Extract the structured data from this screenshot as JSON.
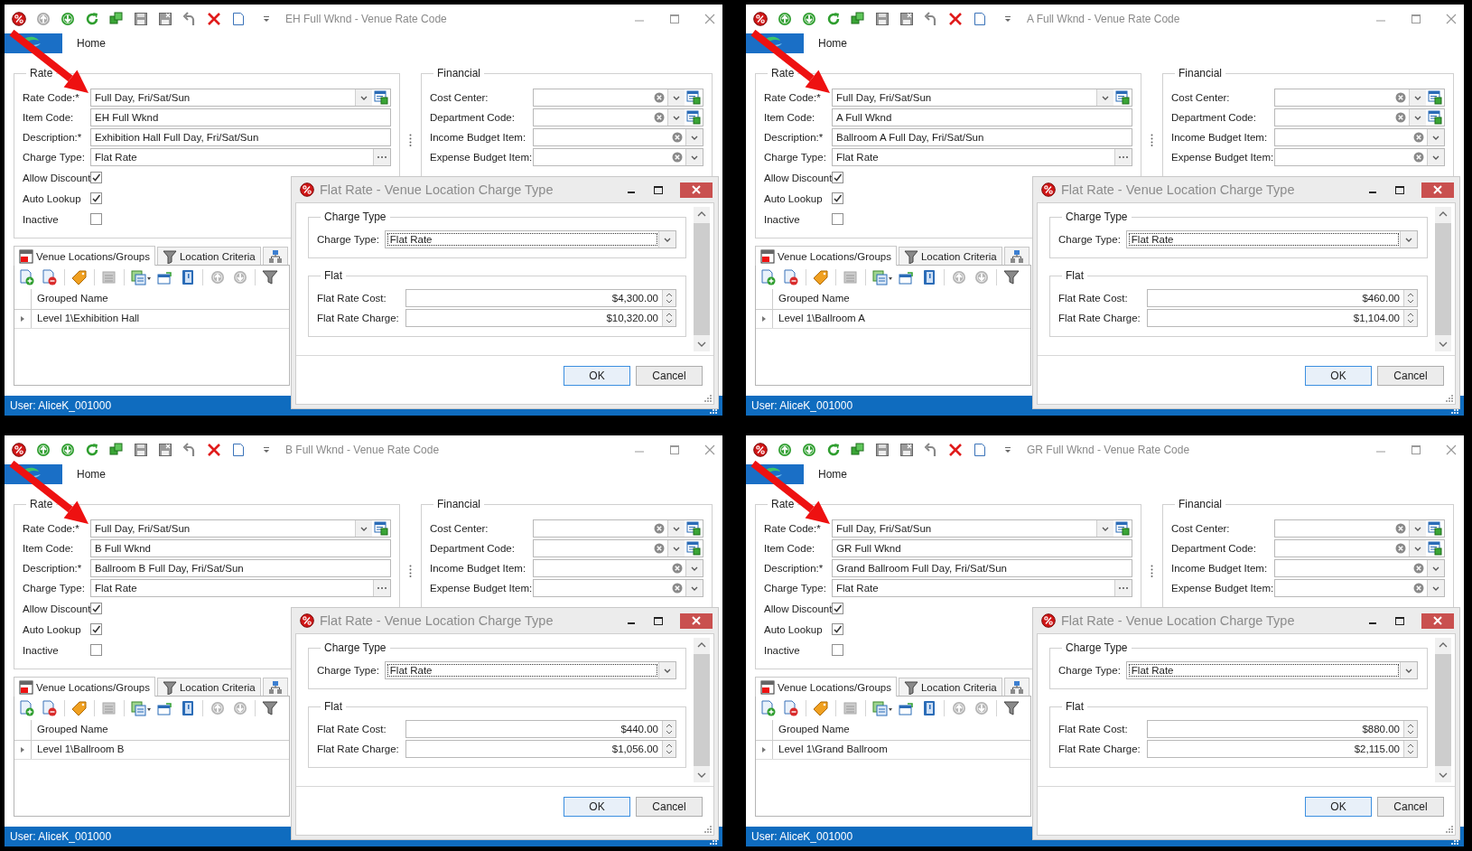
{
  "windows": [
    {
      "title": "EH Full Wknd - Venue Rate Code",
      "move_up": {
        "disabled": true
      },
      "ribbon_tab": "Home",
      "rate": {
        "legend": "Rate",
        "fields": [
          {
            "label": "Rate Code:*",
            "value": "Full Day, Fri/Sat/Sun",
            "kind": "dropdown-lookup"
          },
          {
            "label": "Item Code:",
            "value": "EH Full Wknd",
            "kind": "text"
          },
          {
            "label": "Description:*",
            "value": "Exhibition Hall Full Day, Fri/Sat/Sun",
            "kind": "text"
          },
          {
            "label": "Charge Type:",
            "value": "Flat Rate",
            "kind": "ellipsis"
          }
        ],
        "checks": [
          {
            "label": "Allow Discount",
            "checked": true
          },
          {
            "label": "Auto Lookup",
            "checked": true
          },
          {
            "label": "Inactive",
            "checked": false
          }
        ]
      },
      "financial": {
        "legend": "Financial",
        "fields": [
          {
            "label": "Cost Center:",
            "kind": "clear-dropdown-lookup"
          },
          {
            "label": "Department Code:",
            "kind": "clear-dropdown-lookup"
          },
          {
            "label": "Income Budget Item:",
            "kind": "clear-dropdown"
          },
          {
            "label": "Expense Budget Item:",
            "kind": "clear-dropdown"
          }
        ]
      },
      "tabs": [
        {
          "label": "Venue Locations/Groups",
          "kind": "locations",
          "selected": true
        },
        {
          "label": "Location Criteria",
          "kind": "criteria",
          "selected": false
        },
        {
          "kind": "hierarchy",
          "selected": false
        }
      ],
      "grid": {
        "column": "Grouped Name",
        "rows": [
          "Level 1\\Exhibition Hall"
        ]
      },
      "status_bar": "User: AliceK_001000",
      "dialog": {
        "title": "Flat Rate - Venue Location Charge Type",
        "charge_group": "Charge Type",
        "charge_label": "Charge Type:",
        "charge_value": "Flat Rate",
        "flat_group": "Flat",
        "fields": [
          {
            "label": "Flat Rate Cost:",
            "value": "$4,300.00"
          },
          {
            "label": "Flat Rate Charge:",
            "value": "$10,320.00"
          }
        ],
        "buttons": [
          {
            "label": "OK",
            "default": true
          },
          {
            "label": "Cancel",
            "default": false
          }
        ]
      }
    },
    {
      "title": "A Full Wknd - Venue Rate Code",
      "move_up": {
        "disabled": false
      },
      "ribbon_tab": "Home",
      "rate": {
        "legend": "Rate",
        "fields": [
          {
            "label": "Rate Code:*",
            "value": "Full Day, Fri/Sat/Sun",
            "kind": "dropdown-lookup"
          },
          {
            "label": "Item Code:",
            "value": "A Full Wknd",
            "kind": "text"
          },
          {
            "label": "Description:*",
            "value": "Ballroom A Full Day, Fri/Sat/Sun",
            "kind": "text"
          },
          {
            "label": "Charge Type:",
            "value": "Flat Rate",
            "kind": "ellipsis"
          }
        ],
        "checks": [
          {
            "label": "Allow Discount",
            "checked": true
          },
          {
            "label": "Auto Lookup",
            "checked": true
          },
          {
            "label": "Inactive",
            "checked": false
          }
        ]
      },
      "financial": {
        "legend": "Financial",
        "fields": [
          {
            "label": "Cost Center:",
            "kind": "clear-dropdown-lookup"
          },
          {
            "label": "Department Code:",
            "kind": "clear-dropdown-lookup"
          },
          {
            "label": "Income Budget Item:",
            "kind": "clear-dropdown"
          },
          {
            "label": "Expense Budget Item:",
            "kind": "clear-dropdown"
          }
        ]
      },
      "tabs": [
        {
          "label": "Venue Locations/Groups",
          "kind": "locations",
          "selected": true
        },
        {
          "label": "Location Criteria",
          "kind": "criteria",
          "selected": false
        },
        {
          "kind": "hierarchy",
          "selected": false
        }
      ],
      "grid": {
        "column": "Grouped Name",
        "rows": [
          "Level 1\\Ballroom A"
        ]
      },
      "status_bar": "User: AliceK_001000",
      "dialog": {
        "title": "Flat Rate - Venue Location Charge Type",
        "charge_group": "Charge Type",
        "charge_label": "Charge Type:",
        "charge_value": "Flat Rate",
        "flat_group": "Flat",
        "fields": [
          {
            "label": "Flat Rate Cost:",
            "value": "$460.00"
          },
          {
            "label": "Flat Rate Charge:",
            "value": "$1,104.00"
          }
        ],
        "buttons": [
          {
            "label": "OK",
            "default": true
          },
          {
            "label": "Cancel",
            "default": false
          }
        ]
      }
    },
    {
      "title": "B Full Wknd - Venue Rate Code",
      "move_up": {
        "disabled": false
      },
      "ribbon_tab": "Home",
      "rate": {
        "legend": "Rate",
        "fields": [
          {
            "label": "Rate Code:*",
            "value": "Full Day, Fri/Sat/Sun",
            "kind": "dropdown-lookup"
          },
          {
            "label": "Item Code:",
            "value": "B Full Wknd",
            "kind": "text"
          },
          {
            "label": "Description:*",
            "value": "Ballroom B Full Day, Fri/Sat/Sun",
            "kind": "text"
          },
          {
            "label": "Charge Type:",
            "value": "Flat Rate",
            "kind": "ellipsis"
          }
        ],
        "checks": [
          {
            "label": "Allow Discount",
            "checked": true
          },
          {
            "label": "Auto Lookup",
            "checked": true
          },
          {
            "label": "Inactive",
            "checked": false
          }
        ]
      },
      "financial": {
        "legend": "Financial",
        "fields": [
          {
            "label": "Cost Center:",
            "kind": "clear-dropdown-lookup"
          },
          {
            "label": "Department Code:",
            "kind": "clear-dropdown-lookup"
          },
          {
            "label": "Income Budget Item:",
            "kind": "clear-dropdown"
          },
          {
            "label": "Expense Budget Item:",
            "kind": "clear-dropdown"
          }
        ]
      },
      "tabs": [
        {
          "label": "Venue Locations/Groups",
          "kind": "locations",
          "selected": true
        },
        {
          "label": "Location Criteria",
          "kind": "criteria",
          "selected": false
        },
        {
          "kind": "hierarchy",
          "selected": false
        }
      ],
      "grid": {
        "column": "Grouped Name",
        "rows": [
          "Level 1\\Ballroom B"
        ]
      },
      "status_bar": "User: AliceK_001000",
      "dialog": {
        "title": "Flat Rate - Venue Location Charge Type",
        "charge_group": "Charge Type",
        "charge_label": "Charge Type:",
        "charge_value": "Flat Rate",
        "flat_group": "Flat",
        "fields": [
          {
            "label": "Flat Rate Cost:",
            "value": "$440.00"
          },
          {
            "label": "Flat Rate Charge:",
            "value": "$1,056.00"
          }
        ],
        "buttons": [
          {
            "label": "OK",
            "default": true
          },
          {
            "label": "Cancel",
            "default": false
          }
        ]
      }
    },
    {
      "title": "GR Full Wknd - Venue Rate Code",
      "move_up": {
        "disabled": false
      },
      "ribbon_tab": "Home",
      "rate": {
        "legend": "Rate",
        "fields": [
          {
            "label": "Rate Code:*",
            "value": "Full Day, Fri/Sat/Sun",
            "kind": "dropdown-lookup"
          },
          {
            "label": "Item Code:",
            "value": "GR Full Wknd",
            "kind": "text"
          },
          {
            "label": "Description:*",
            "value": "Grand Ballroom Full Day, Fri/Sat/Sun",
            "kind": "text"
          },
          {
            "label": "Charge Type:",
            "value": "Flat Rate",
            "kind": "ellipsis"
          }
        ],
        "checks": [
          {
            "label": "Allow Discount",
            "checked": true
          },
          {
            "label": "Auto Lookup",
            "checked": true
          },
          {
            "label": "Inactive",
            "checked": false
          }
        ]
      },
      "financial": {
        "legend": "Financial",
        "fields": [
          {
            "label": "Cost Center:",
            "kind": "clear-dropdown-lookup"
          },
          {
            "label": "Department Code:",
            "kind": "clear-dropdown-lookup"
          },
          {
            "label": "Income Budget Item:",
            "kind": "clear-dropdown"
          },
          {
            "label": "Expense Budget Item:",
            "kind": "clear-dropdown"
          }
        ]
      },
      "tabs": [
        {
          "label": "Venue Locations/Groups",
          "kind": "locations",
          "selected": true
        },
        {
          "label": "Location Criteria",
          "kind": "criteria",
          "selected": false
        },
        {
          "kind": "hierarchy",
          "selected": false
        }
      ],
      "grid": {
        "column": "Grouped Name",
        "rows": [
          "Level 1\\Grand Ballroom"
        ]
      },
      "status_bar": "User: AliceK_001000",
      "dialog": {
        "title": "Flat Rate - Venue Location Charge Type",
        "charge_group": "Charge Type",
        "charge_label": "Charge Type:",
        "charge_value": "Flat Rate",
        "flat_group": "Flat",
        "fields": [
          {
            "label": "Flat Rate Cost:",
            "value": "$880.00"
          },
          {
            "label": "Flat Rate Charge:",
            "value": "$2,115.00"
          }
        ],
        "buttons": [
          {
            "label": "OK",
            "default": true
          },
          {
            "label": "Cancel",
            "default": false
          }
        ]
      }
    }
  ]
}
